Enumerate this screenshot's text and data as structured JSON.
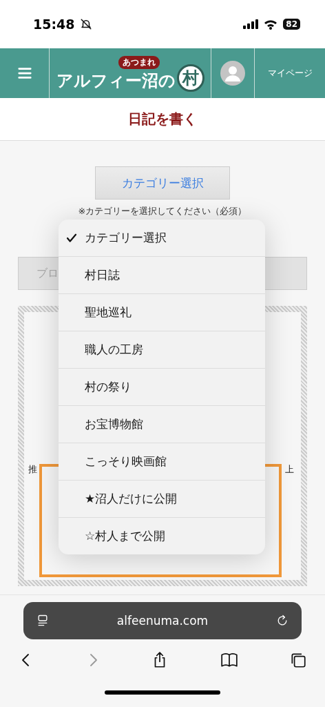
{
  "status_bar": {
    "time": "15:48",
    "silent": true,
    "battery": "82"
  },
  "header": {
    "logo": {
      "main": "アルフィー沼の",
      "badge": "あつまれ",
      "emblem": "村"
    },
    "mypage": "マイページ"
  },
  "page_title": "日記を書く",
  "form": {
    "category_button": "カテゴリー選択",
    "note": "※カテゴリーを選択してください（必須）",
    "title_field_visible": "ブロ",
    "hint_left": "推",
    "hint_right": "上"
  },
  "menu": {
    "items": [
      {
        "label": "カテゴリー選択",
        "selected": true
      },
      {
        "label": "村日誌",
        "selected": false
      },
      {
        "label": "聖地巡礼",
        "selected": false
      },
      {
        "label": "職人の工房",
        "selected": false
      },
      {
        "label": "村の祭り",
        "selected": false
      },
      {
        "label": "お宝博物館",
        "selected": false
      },
      {
        "label": "こっそり映画館",
        "selected": false
      },
      {
        "label": "★沼人だけに公開",
        "selected": false
      },
      {
        "label": "☆村人まで公開",
        "selected": false
      }
    ]
  },
  "browser": {
    "url": "alfeenuma.com"
  }
}
